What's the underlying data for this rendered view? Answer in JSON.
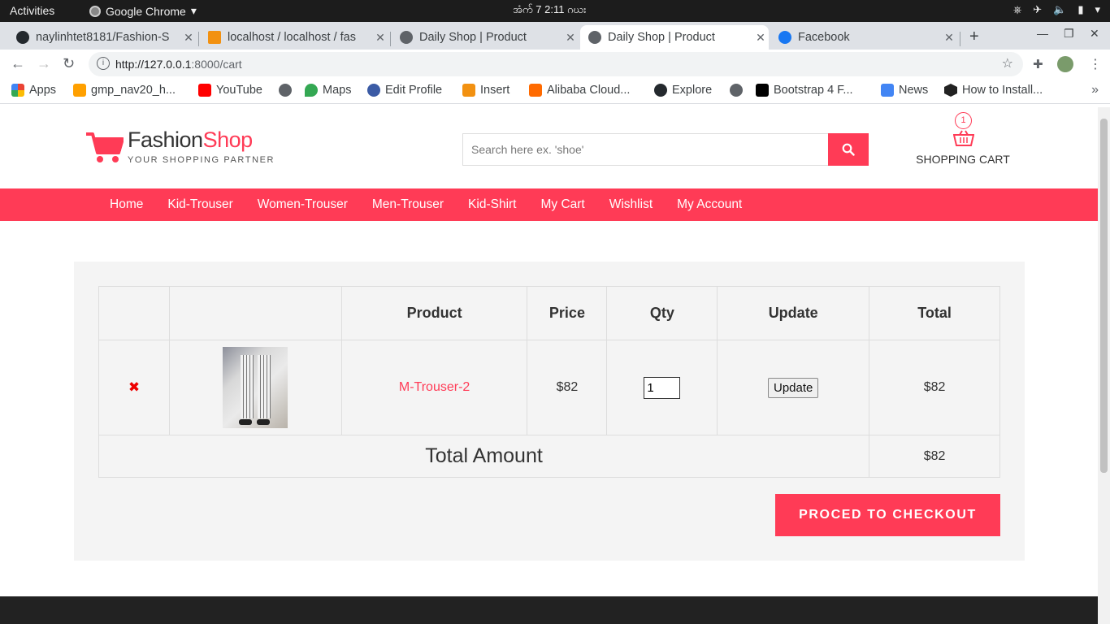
{
  "os": {
    "activities": "Activities",
    "app_name": "Google Chrome",
    "clock": "အံက် 7   2:11 ဂဃး"
  },
  "browser": {
    "tabs": [
      {
        "title": "naylinhtet8181/Fashion-S",
        "active": false
      },
      {
        "title": "localhost / localhost / fas",
        "active": false
      },
      {
        "title": "Daily Shop | Product",
        "active": false
      },
      {
        "title": "Daily Shop | Product",
        "active": true
      },
      {
        "title": "Facebook",
        "active": false
      }
    ],
    "url_host": "http://127.0.0.1",
    "url_path": ":8000/cart",
    "bookmarks": [
      {
        "label": "Apps",
        "icon": "apps-grid-icon"
      },
      {
        "label": "gmp_nav20_h...",
        "icon": "firebase-icon"
      },
      {
        "label": "YouTube",
        "icon": "youtube-icon"
      },
      {
        "label": "",
        "icon": "globe-icon"
      },
      {
        "label": "Maps",
        "icon": "maps-pin-icon"
      },
      {
        "label": "Edit Profile",
        "icon": "profile-icon"
      },
      {
        "label": "Insert",
        "icon": "phpmyadmin-icon"
      },
      {
        "label": "Alibaba Cloud...",
        "icon": "alibaba-icon"
      },
      {
        "label": "Explore",
        "icon": "github-icon"
      },
      {
        "label": "",
        "icon": "globe-icon"
      },
      {
        "label": "Bootstrap 4 F...",
        "icon": "medium-icon"
      },
      {
        "label": "News",
        "icon": "news-icon"
      },
      {
        "label": "How to Install...",
        "icon": "hex-icon"
      }
    ]
  },
  "site": {
    "brand_part1": "Fashion",
    "brand_part2": "Shop",
    "tagline": "YOUR SHOPPING PARTNER",
    "search_placeholder": "Search here ex. 'shoe'",
    "cart_count": "1",
    "cart_label": "SHOPPING CART",
    "menu": [
      "Home",
      "Kid-Trouser",
      "Women-Trouser",
      "Men-Trouser",
      "Kid-Shirt",
      "My Cart",
      "Wishlist",
      "My Account"
    ],
    "accent": "#ff3b56"
  },
  "cart": {
    "headers": [
      "",
      "",
      "Product",
      "Price",
      "Qty",
      "Update",
      "Total"
    ],
    "items": [
      {
        "remove": "✖",
        "product": "M-Trouser-2",
        "price": "$82",
        "qty": "1",
        "update_label": "Update",
        "total": "$82"
      }
    ],
    "total_label": "Total Amount",
    "total_value": "$82",
    "checkout_label": "PROCED TO CHECKOUT"
  }
}
